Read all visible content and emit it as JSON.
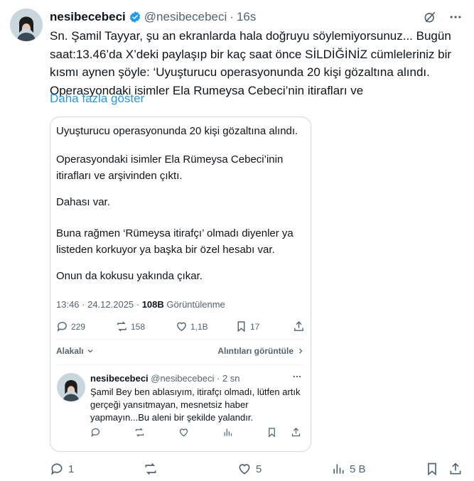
{
  "author": {
    "name": "nesibecebeci",
    "handle": "@nesibecebeci",
    "separator": "·",
    "time": "16s"
  },
  "tweet": {
    "text": "Sn. Şamil Tayyar, şu an ekranlarda hala doğruyu söylemiyorsunuz... Bugün saat:13.46’da X’deki paylaşıp bir kaç saat önce SİLDİĞİNİZ cümleleriniz bir kısmı aynen şöyle: ‘Uyuşturucu operasyonunda 20 kişi gözaltına alındı. Operasyondaki isimler Ela Rumeysa Cebeci’nin itirafları ve",
    "show_more": "Daha fazla göster"
  },
  "quoted": {
    "paragraphs": [
      "Uyuşturucu operasyonunda 20 kişi gözaltına alındı.",
      "Operasyondaki isimler Ela Rümeysa Cebeci’inin itirafları ve arşivinden çıktı.",
      "Dahası var.",
      "Buna rağmen ‘Rümeysa itirafçı’ olmadı diyenler ya listeden korkuyor ya başka bir özel hesabı var.",
      "Onun da kokusu yakında çıkar."
    ],
    "meta": {
      "time_date": "13:46 · 24.12.2025 · ",
      "views_count": "108B",
      "views_label": " Görüntülenme"
    },
    "stats": {
      "replies": "229",
      "reposts": "158",
      "likes": "1,1B",
      "bookmarks": "17"
    },
    "links": {
      "relevance": "Alakalı",
      "view_quotes": "Alıntıları görüntüle"
    },
    "reply": {
      "name": "nesibecebeci",
      "handle": "@nesibecebeci",
      "time": "· 2 sn",
      "text": "Şamil Bey ben ablasıyım, itirafçı olmadı, lütfen artık gerçeği yansıtmayan, mesnetsiz haber yapmayın...Bu aleni bir şekilde yalandır."
    }
  },
  "actions": {
    "replies": "1",
    "likes": "5",
    "views": "5 B"
  },
  "icons": {
    "verified": "verified-badge-icon",
    "grok": "grok-icon",
    "more": "more-icon",
    "reply": "reply-icon",
    "repost": "repost-icon",
    "like": "heart-icon",
    "views": "views-icon",
    "bookmark": "bookmark-icon",
    "share": "share-icon"
  },
  "colors": {
    "accent": "#1d9bf0",
    "muted": "#536471",
    "text": "#0f1419",
    "border": "#cfd9de"
  }
}
